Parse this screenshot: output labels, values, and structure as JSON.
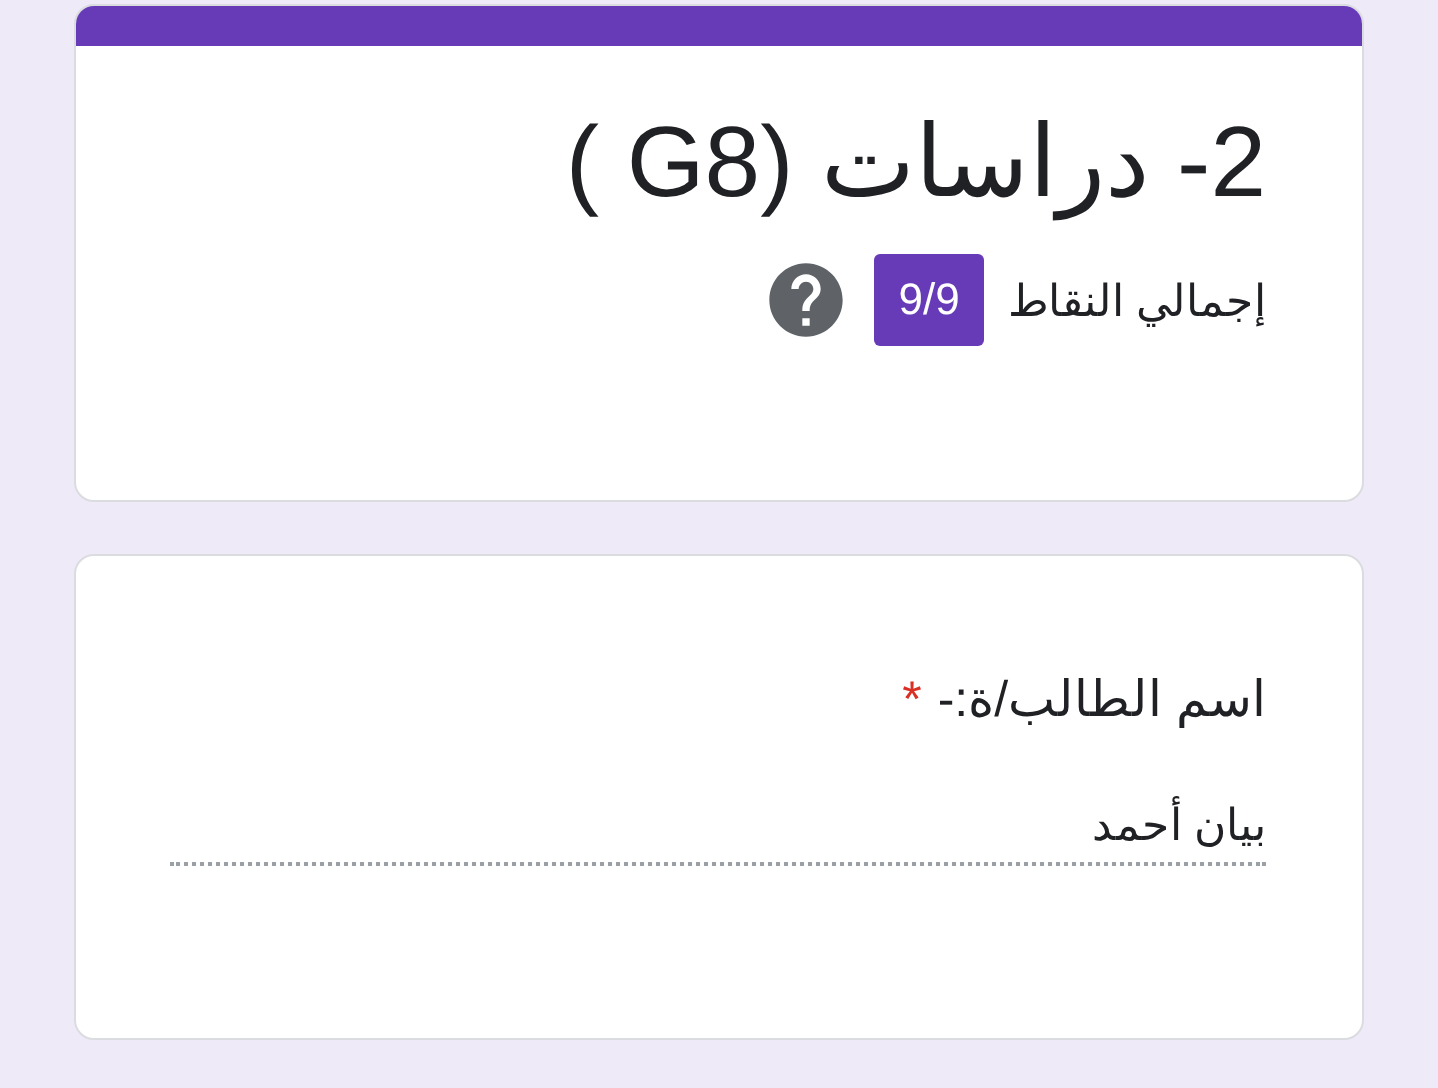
{
  "form": {
    "title": "2- دراسات (G8 )",
    "points_label": "إجمالي النقاط",
    "points": "9/9"
  },
  "questions": [
    {
      "label": "اسم الطالب/ة:-",
      "required_mark": "*",
      "answer": "بيان أحمد"
    }
  ]
}
